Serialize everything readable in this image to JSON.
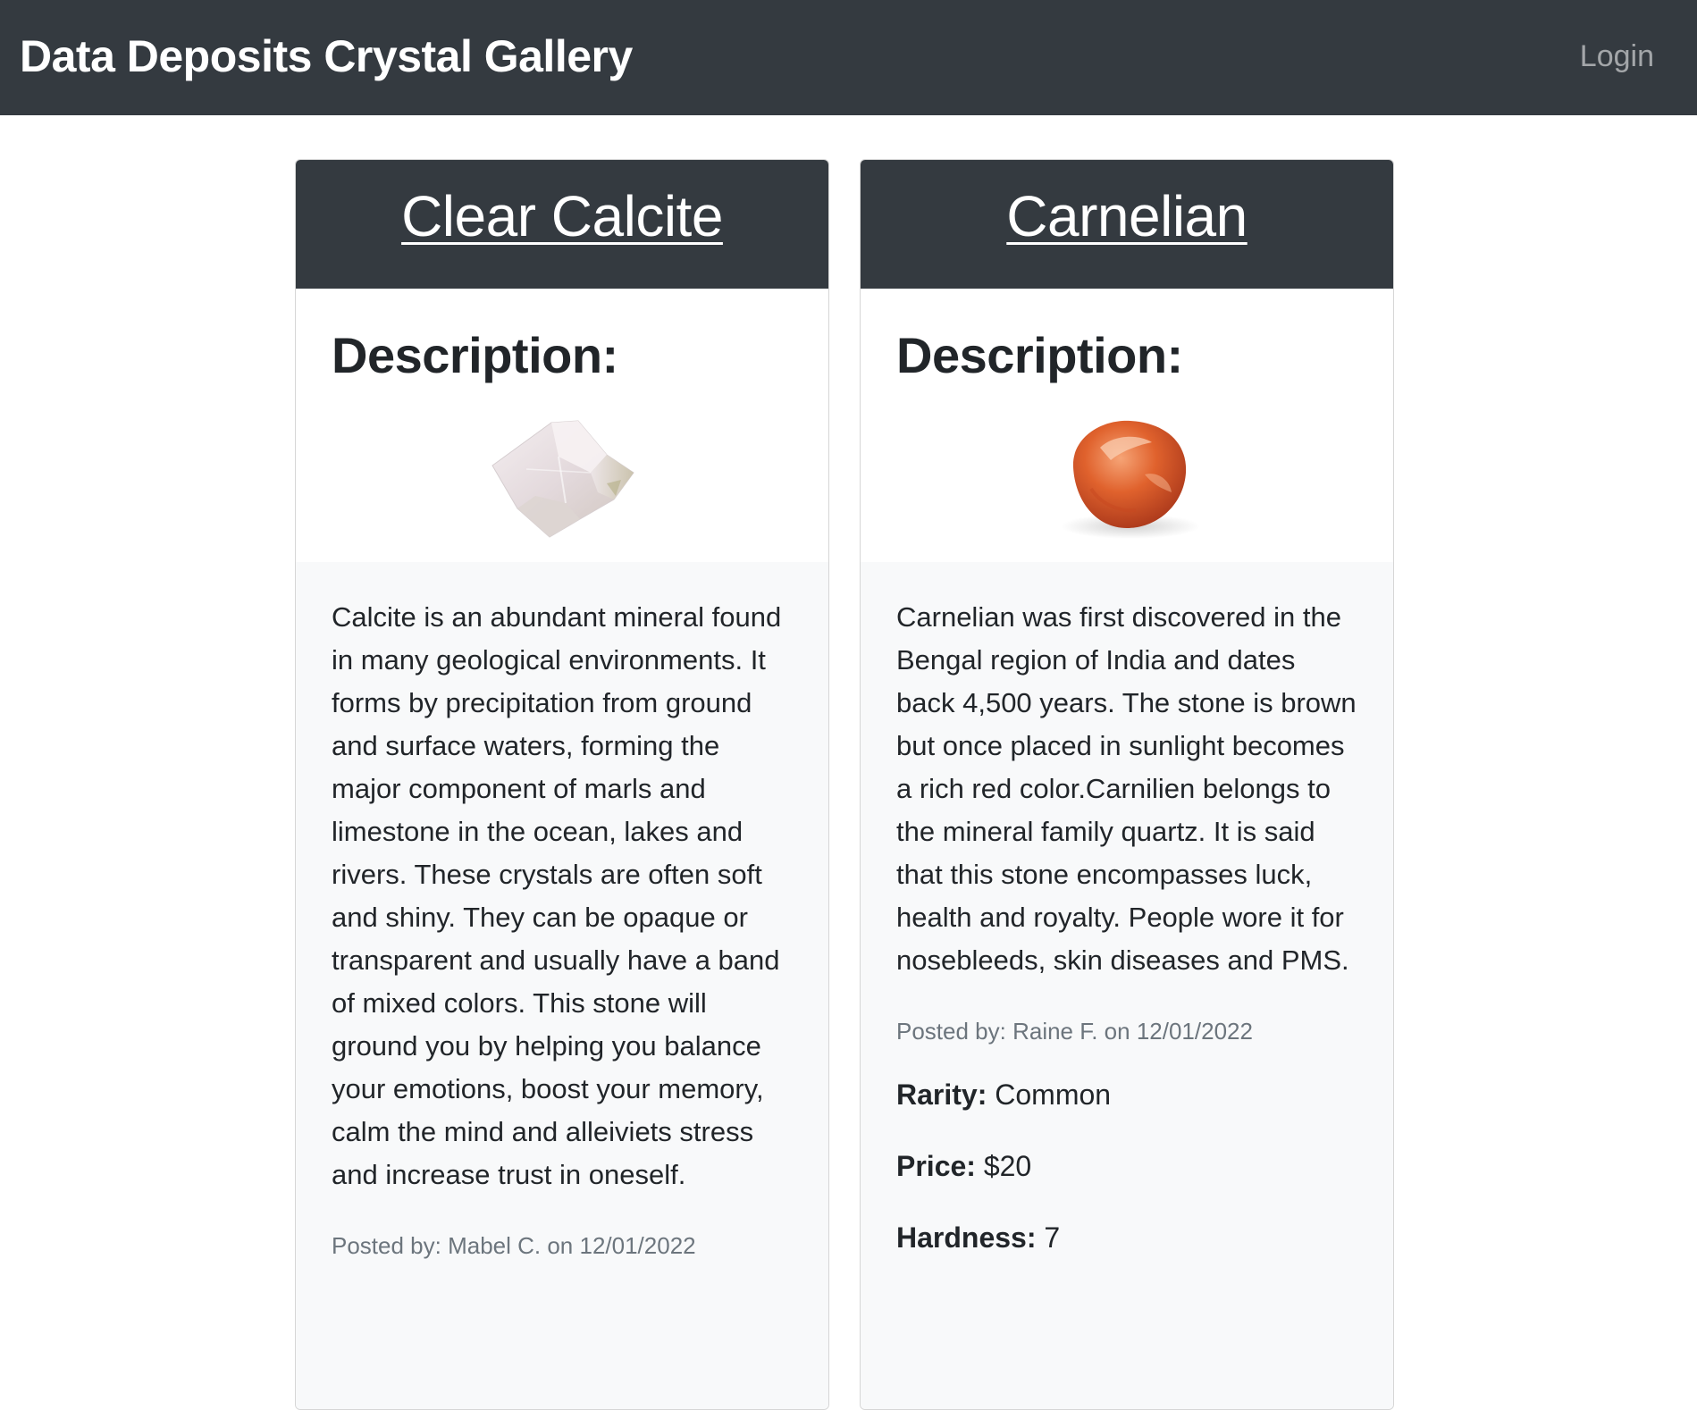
{
  "navbar": {
    "brand": "Data Deposits Crystal Gallery",
    "login_label": "Login"
  },
  "cards": [
    {
      "title": "Clear Calcite",
      "description_heading": "Description:",
      "image_icon": "calcite-crystal-image",
      "description": "Calcite is an abundant mineral found in many geological environments. It forms by precipitation from ground and surface waters, forming the major component of marls and limestone in the ocean, lakes and rivers. These crystals are often soft and shiny. They can be opaque or transparent and usually have a band of mixed colors. This stone will ground you by helping you balance your emotions, boost your memory, calm the mind and alleiviets stress and increase trust in oneself.",
      "posted": "Posted by: Mabel C. on 12/01/2022"
    },
    {
      "title": "Carnelian",
      "description_heading": "Description:",
      "image_icon": "carnelian-stone-image",
      "description": "Carnelian was first discovered in the Bengal region of India and dates back 4,500 years. The stone is brown but once placed in sunlight becomes a rich red color.Carnilien belongs to the mineral family quartz. It is said that this stone encompasses luck, health and royalty. People wore it for nosebleeds, skin diseases and PMS.",
      "posted": "Posted by: Raine F. on 12/01/2022",
      "rarity_label": "Rarity:",
      "rarity": "Common",
      "price_label": "Price:",
      "price": "$20",
      "hardness_label": "Hardness:",
      "hardness": "7"
    }
  ],
  "colors": {
    "navbar_bg": "#343a40",
    "card_body_bg": "#f8f9fa",
    "muted_text": "#6c757d"
  }
}
